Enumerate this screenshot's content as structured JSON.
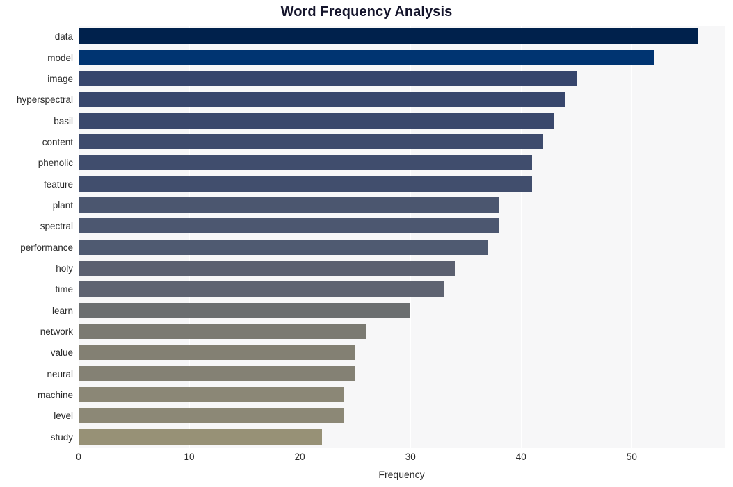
{
  "chart_data": {
    "type": "bar",
    "orientation": "horizontal",
    "title": "Word Frequency Analysis",
    "xlabel": "Frequency",
    "ylabel": "",
    "categories": [
      "data",
      "model",
      "image",
      "hyperspectral",
      "basil",
      "content",
      "phenolic",
      "feature",
      "plant",
      "spectral",
      "performance",
      "holy",
      "time",
      "learn",
      "network",
      "value",
      "neural",
      "machine",
      "level",
      "study"
    ],
    "values": [
      56,
      52,
      45,
      44,
      43,
      42,
      41,
      41,
      38,
      38,
      37,
      34,
      33,
      30,
      26,
      25,
      25,
      24,
      24,
      22
    ],
    "bar_colors": [
      "#00214c",
      "#003471",
      "#36456c",
      "#37466c",
      "#3a486c",
      "#3e4b6d",
      "#404d6d",
      "#414e6d",
      "#4b566f",
      "#4c5770",
      "#4f5a71",
      "#5b6070",
      "#5e6371",
      "#6b6e70",
      "#7b7a72",
      "#838073",
      "#848174",
      "#8b8776",
      "#8c8876",
      "#979176"
    ],
    "xlim": [
      0,
      58.4
    ],
    "ylim": [
      0,
      20
    ],
    "xticks": [
      0,
      10,
      20,
      30,
      40,
      50
    ],
    "xtick_labels": [
      "0",
      "10",
      "20",
      "30",
      "40",
      "50"
    ],
    "grid": {
      "vertical": true,
      "horizontal": false,
      "color": "#ffffff"
    },
    "legend": null,
    "plot_background": "#f7f7f8",
    "figure_background": "#ffffff",
    "title_color": "#14142b",
    "tick_label_color": "#2a2a2a"
  }
}
